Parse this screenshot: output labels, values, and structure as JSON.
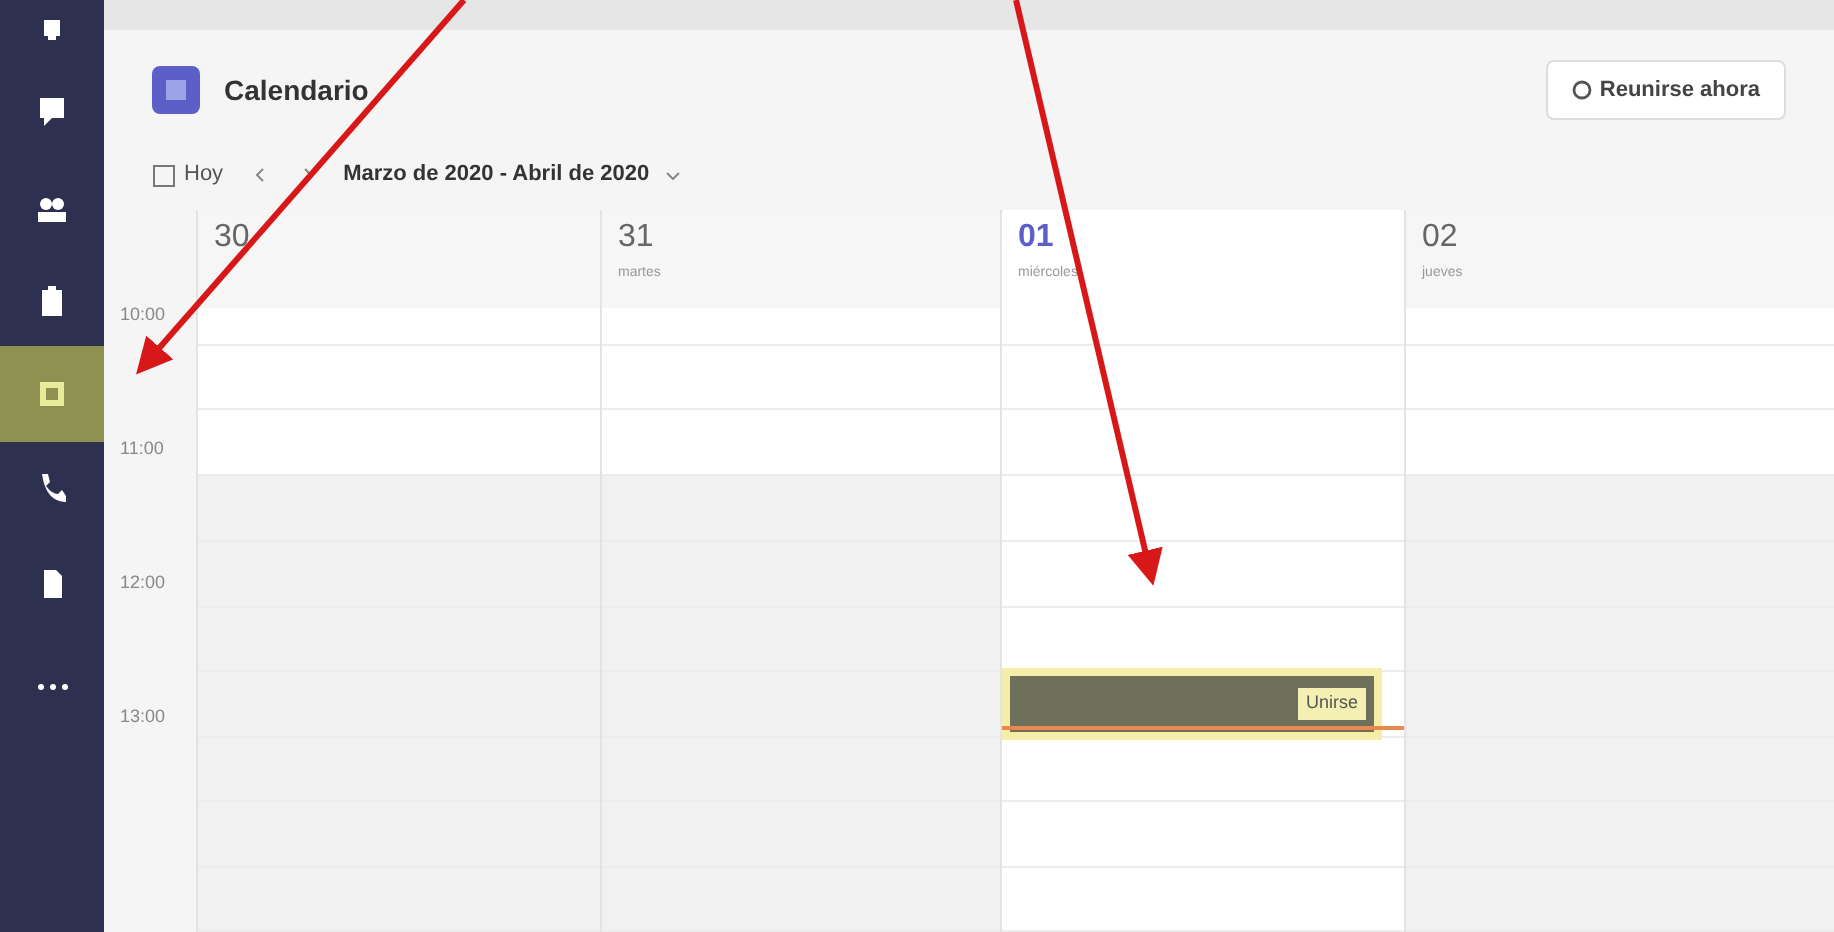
{
  "sidebar": {
    "items": [
      {
        "kind": "bell",
        "selected": false
      },
      {
        "kind": "chat",
        "selected": false
      },
      {
        "kind": "team",
        "selected": false
      },
      {
        "kind": "bag",
        "selected": false
      },
      {
        "kind": "calendar",
        "selected": true
      },
      {
        "kind": "phone",
        "selected": false
      },
      {
        "kind": "file",
        "selected": false
      },
      {
        "kind": "more",
        "selected": false
      }
    ]
  },
  "header": {
    "title": "Calendario",
    "meet_button": "Reunirse ahora"
  },
  "toolbar": {
    "today": "Hoy",
    "range": "Marzo de 2020 - Abril de 2020"
  },
  "days": [
    {
      "number": "30",
      "today": false
    },
    {
      "number": "31",
      "weekday": "martes",
      "today": false
    },
    {
      "number": "01",
      "weekday": "miércoles",
      "today": true
    },
    {
      "number": "02",
      "weekday": "jueves",
      "today": false
    }
  ],
  "times": [
    "10:00",
    "11:00",
    "12:00",
    "13:00"
  ],
  "event": {
    "join_button": "Unirse"
  }
}
